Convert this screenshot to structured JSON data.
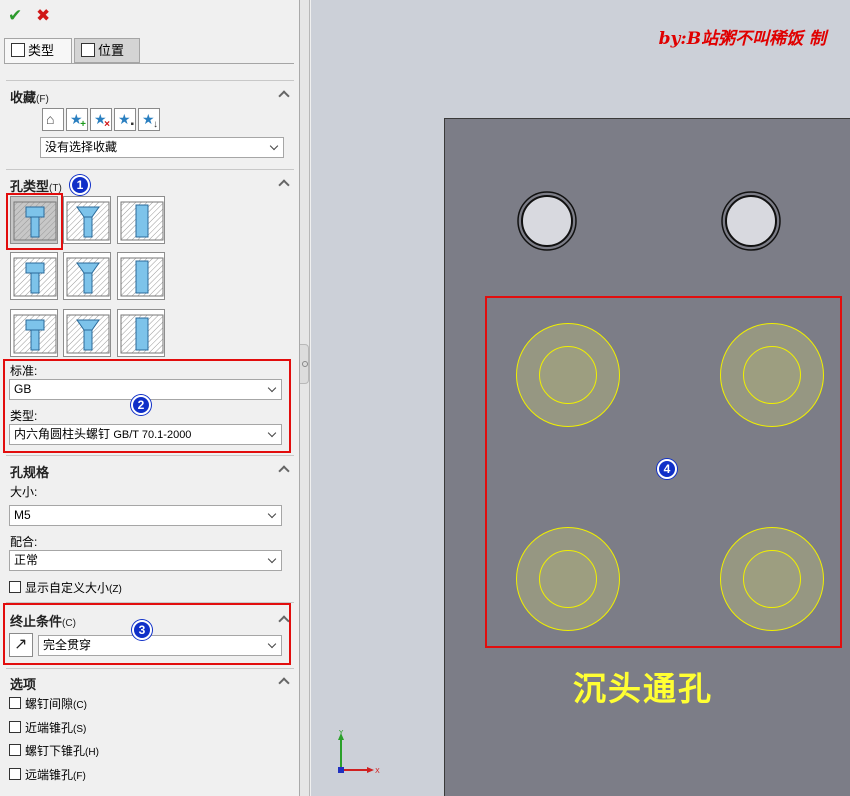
{
  "toolbar": {
    "ok_symbol": "✔",
    "cancel_symbol": "✖"
  },
  "tabs": [
    {
      "label": "类型"
    },
    {
      "label": "位置"
    }
  ],
  "favorites": {
    "title": "收藏",
    "title_shortcut": "(F)",
    "buttons": [
      {
        "icon": "apply-defaults-icon"
      },
      {
        "icon": "add-favorite-icon"
      },
      {
        "icon": "delete-favorite-icon"
      },
      {
        "icon": "save-favorite-icon"
      },
      {
        "icon": "load-favorite-icon"
      }
    ],
    "selected": "没有选择收藏"
  },
  "hole_type": {
    "title": "孔类型",
    "title_shortcut": "(T)",
    "types": [
      {
        "icon": "counterbore-icon",
        "selected": true
      },
      {
        "icon": "countersink-icon"
      },
      {
        "icon": "simple-hole-icon"
      },
      {
        "icon": "tapped-hole-icon"
      },
      {
        "icon": "straight-pipe-tap-icon"
      },
      {
        "icon": "legacy-hole-icon"
      },
      {
        "icon": "counterbore-slot-icon"
      },
      {
        "icon": "countersink-slot-icon"
      },
      {
        "icon": "slot-icon"
      }
    ],
    "standard_label": "标准:",
    "standard_value": "GB",
    "type_label": "类型:",
    "type_value": "内六角圆柱头螺钉",
    "type_value_suffix": "GB/T 70.1-2000"
  },
  "hole_spec": {
    "title": "孔规格",
    "size_label": "大小:",
    "size_value": "M5",
    "fit_label": "配合:",
    "fit_value": "正常",
    "custom_size_label": "显示自定义大小",
    "custom_size_shortcut": "(Z)"
  },
  "end_condition": {
    "title": "终止条件",
    "title_shortcut": "(C)",
    "value": "完全贯穿"
  },
  "options": {
    "title": "选项",
    "items": [
      {
        "label": "螺钉间隙",
        "shortcut": "(C)"
      },
      {
        "label": "近端锥孔",
        "shortcut": "(S)"
      },
      {
        "label": "螺钉下锥孔",
        "shortcut": "(H)"
      },
      {
        "label": "远端锥孔",
        "shortcut": "(F)"
      }
    ]
  },
  "annotations": {
    "badges": [
      "1",
      "2",
      "3",
      "4"
    ],
    "credit": "by:B站粥不叫稀饭 制",
    "caption": "沉头通孔",
    "highlight_color": "#e20d0d",
    "badge_color": "#1030c8"
  },
  "axes": {
    "x": "X",
    "y": "Y"
  },
  "colors": {
    "plate": "#7c7d87",
    "background": "#ccd0d8",
    "preview": "#f0f000",
    "caption": "#ffff33"
  }
}
